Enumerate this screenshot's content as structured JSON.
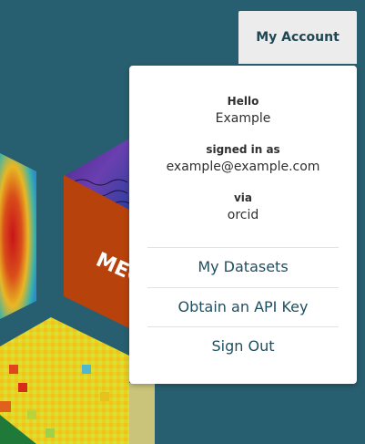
{
  "account_button": {
    "label": "My Account"
  },
  "dropdown": {
    "hello_label": "Hello",
    "user_name": "Example",
    "signed_in_label": "signed in as",
    "email": "example@example.com",
    "via_label": "via",
    "provider": "orcid",
    "links": [
      {
        "label": "My Datasets"
      },
      {
        "label": "Obtain an API Key"
      },
      {
        "label": "Sign Out"
      }
    ]
  },
  "background": {
    "cube_text": "MEG",
    "colors": {
      "page": "#275f70",
      "cube_orange": "#b8420c",
      "dropdown_bg": "#ffffff",
      "link": "#1f4f61"
    }
  }
}
